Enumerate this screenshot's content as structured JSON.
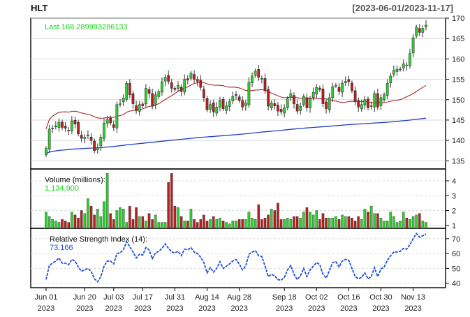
{
  "header": {
    "symbol": "HLT",
    "date_range": "[2023-06-01/2023-11-17]"
  },
  "colors": {
    "up": "#32cd32",
    "down": "#b22222",
    "sma50": "#a52a2a",
    "sma200": "#1e3ccf",
    "rsi": "#1e4fd6",
    "last_text": "#22cc22",
    "grid": "#d9d9d9"
  },
  "chart_data": [
    {
      "type": "candlestick",
      "title": "HLT",
      "label": "Last 168.289993286133",
      "x": [
        "2023-06-01",
        "2023-06-02",
        "2023-06-05",
        "2023-06-06",
        "2023-06-07",
        "2023-06-08",
        "2023-06-09",
        "2023-06-12",
        "2023-06-13",
        "2023-06-14",
        "2023-06-15",
        "2023-06-16",
        "2023-06-20",
        "2023-06-21",
        "2023-06-22",
        "2023-06-23",
        "2023-06-26",
        "2023-06-27",
        "2023-06-28",
        "2023-06-29",
        "2023-06-30",
        "2023-07-03",
        "2023-07-05",
        "2023-07-06",
        "2023-07-07",
        "2023-07-10",
        "2023-07-11",
        "2023-07-12",
        "2023-07-13",
        "2023-07-14",
        "2023-07-17",
        "2023-07-18",
        "2023-07-19",
        "2023-07-20",
        "2023-07-21",
        "2023-07-24",
        "2023-07-25",
        "2023-07-26",
        "2023-07-27",
        "2023-07-28",
        "2023-07-31",
        "2023-08-01",
        "2023-08-02",
        "2023-08-03",
        "2023-08-04",
        "2023-08-07",
        "2023-08-08",
        "2023-08-09",
        "2023-08-10",
        "2023-08-11",
        "2023-08-14",
        "2023-08-15",
        "2023-08-16",
        "2023-08-17",
        "2023-08-18",
        "2023-08-21",
        "2023-08-22",
        "2023-08-23",
        "2023-08-24",
        "2023-08-25",
        "2023-08-28",
        "2023-08-29",
        "2023-08-30",
        "2023-08-31",
        "2023-09-01",
        "2023-09-05",
        "2023-09-06",
        "2023-09-07",
        "2023-09-08",
        "2023-09-11",
        "2023-09-12",
        "2023-09-13",
        "2023-09-14",
        "2023-09-15",
        "2023-09-18",
        "2023-09-19",
        "2023-09-20",
        "2023-09-21",
        "2023-09-22",
        "2023-09-25",
        "2023-09-26",
        "2023-09-27",
        "2023-09-28",
        "2023-09-29",
        "2023-10-02",
        "2023-10-03",
        "2023-10-04",
        "2023-10-05",
        "2023-10-06",
        "2023-10-09",
        "2023-10-10",
        "2023-10-11",
        "2023-10-12",
        "2023-10-13",
        "2023-10-16",
        "2023-10-17",
        "2023-10-18",
        "2023-10-19",
        "2023-10-20",
        "2023-10-23",
        "2023-10-24",
        "2023-10-25",
        "2023-10-26",
        "2023-10-27",
        "2023-10-30",
        "2023-10-31",
        "2023-11-01",
        "2023-11-02",
        "2023-11-03",
        "2023-11-06",
        "2023-11-07",
        "2023-11-08",
        "2023-11-09",
        "2023-11-10",
        "2023-11-13",
        "2023-11-14",
        "2023-11-15",
        "2023-11-16",
        "2023-11-17"
      ],
      "close": [
        138.0,
        142.8,
        143.0,
        143.5,
        144.5,
        143.2,
        143.0,
        142.5,
        144.8,
        144.0,
        141.6,
        140.5,
        140.8,
        141.3,
        140.0,
        137.5,
        138.2,
        140.8,
        144.2,
        145.2,
        144.3,
        143.2,
        148.8,
        149.0,
        150.4,
        154.0,
        151.2,
        149.0,
        147.3,
        148.8,
        148.5,
        152.8,
        151.5,
        148.4,
        151.2,
        152.0,
        154.4,
        155.5,
        154.5,
        152.8,
        152.5,
        153.5,
        152.0,
        155.0,
        154.8,
        156.5,
        155.0,
        154.5,
        153.0,
        150.5,
        147.5,
        148.8,
        147.0,
        148.2,
        149.8,
        147.8,
        148.5,
        149.5,
        150.8,
        151.0,
        149.8,
        148.2,
        149.2,
        154.3,
        155.8,
        157.0,
        155.5,
        155.2,
        152.2,
        148.4,
        149.2,
        148.5,
        147.2,
        147.0,
        148.0,
        150.2,
        151.5,
        149.0,
        147.2,
        148.4,
        150.8,
        148.0,
        150.2,
        151.8,
        153.0,
        152.5,
        149.0,
        147.8,
        150.5,
        153.2,
        153.5,
        152.0,
        154.0,
        154.5,
        154.4,
        152.2,
        149.5,
        148.2,
        148.8,
        150.0,
        148.0,
        148.5,
        151.5,
        148.2,
        150.5,
        151.2,
        154.0,
        155.8,
        157.2,
        157.5,
        157.5,
        158.8,
        158.5,
        161.3,
        165.2,
        167.8,
        166.5,
        167.5,
        168.29
      ],
      "sma50_endpoints": {
        "start": 142.8,
        "end": 153.5
      },
      "sma200_endpoints": {
        "start": 136.8,
        "end": 147.3
      },
      "ylim": [
        133,
        170
      ],
      "yticks": [
        135,
        140,
        145,
        150,
        155,
        160,
        165,
        170
      ]
    },
    {
      "type": "bar",
      "label": "Volume (millions):",
      "value_label": "1,134,900",
      "volume": [
        1.9,
        1.6,
        1.4,
        1.3,
        1.2,
        1.4,
        1.3,
        1.2,
        1.9,
        1.7,
        1.5,
        2.0,
        1.8,
        2.8,
        2.3,
        1.7,
        2.1,
        1.6,
        2.6,
        4.5,
        1.8,
        1.4,
        2.0,
        2.2,
        2.1,
        1.2,
        2.3,
        1.4,
        2.2,
        1.6,
        1.6,
        1.3,
        1.8,
        1.4,
        1.7,
        1.2,
        1.2,
        1.2,
        3.9,
        4.5,
        2.3,
        2.2,
        1.6,
        1.3,
        1.3,
        2.1,
        1.4,
        1.2,
        1.4,
        1.7,
        1.3,
        1.4,
        1.6,
        1.4,
        1.5,
        1.3,
        1.2,
        1.1,
        1.3,
        1.3,
        1.4,
        1.4,
        1.4,
        1.9,
        1.5,
        1.4,
        2.4,
        1.4,
        1.5,
        1.7,
        2.1,
        2.0,
        2.5,
        1.4,
        1.4,
        1.5,
        1.4,
        1.6,
        1.6,
        1.5,
        1.9,
        2.2,
        1.9,
        1.7,
        2.0,
        1.4,
        1.8,
        1.5,
        1.5,
        1.5,
        1.6,
        1.4,
        1.7,
        1.6,
        1.6,
        1.5,
        1.3,
        1.6,
        1.4,
        2.1,
        1.9,
        2.3,
        1.8,
        1.8,
        1.5,
        1.3,
        1.3,
        1.9,
        1.6,
        1.2,
        1.3,
        1.9,
        1.5,
        1.4,
        1.6,
        1.7,
        1.8,
        1.3,
        1.2
      ],
      "ylim": [
        0.8,
        4.8
      ],
      "yticks": [
        1,
        2,
        3,
        4
      ]
    },
    {
      "type": "line",
      "label": "Relative Strength Index (14):",
      "value_label": "73.166",
      "rsi": [
        42.5,
        52.0,
        53.5,
        55.0,
        57.0,
        53.5,
        53.5,
        52.5,
        56.0,
        55.0,
        51.0,
        48.0,
        49.0,
        50.0,
        48.0,
        43.0,
        41.0,
        44.5,
        51.5,
        55.0,
        55.0,
        53.0,
        60.0,
        60.5,
        62.5,
        68.0,
        64.5,
        61.0,
        57.0,
        59.5,
        59.0,
        64.0,
        62.5,
        56.5,
        60.5,
        61.5,
        63.5,
        66.5,
        63.5,
        61.0,
        60.5,
        61.5,
        58.5,
        63.0,
        62.5,
        64.0,
        61.0,
        60.0,
        57.5,
        54.0,
        47.0,
        50.5,
        47.5,
        50.0,
        54.5,
        50.0,
        51.5,
        53.0,
        55.0,
        56.0,
        53.0,
        49.0,
        51.5,
        59.5,
        61.0,
        62.0,
        58.5,
        58.0,
        51.5,
        44.5,
        46.0,
        45.0,
        42.5,
        42.0,
        44.0,
        49.0,
        52.0,
        46.0,
        42.5,
        45.0,
        50.0,
        44.5,
        49.0,
        51.5,
        54.0,
        52.5,
        46.0,
        43.5,
        48.5,
        54.0,
        54.5,
        51.0,
        55.0,
        56.0,
        55.5,
        50.0,
        44.5,
        43.0,
        44.0,
        47.0,
        43.0,
        44.5,
        50.5,
        44.5,
        49.5,
        51.0,
        55.5,
        58.5,
        61.0,
        61.0,
        61.5,
        63.5,
        63.0,
        66.0,
        70.0,
        73.5,
        71.0,
        72.0,
        73.166
      ],
      "ylim": [
        37,
        77
      ],
      "yticks": [
        40,
        50,
        60,
        70
      ]
    }
  ],
  "x_axis": {
    "ticks": [
      {
        "label": "Jun 01",
        "year": "2023",
        "index": 0
      },
      {
        "label": "Jun 20",
        "year": "2023",
        "index": 12
      },
      {
        "label": "Jul 03",
        "year": "2023",
        "index": 21
      },
      {
        "label": "Jul 17",
        "year": "2023",
        "index": 30
      },
      {
        "label": "Jul 31",
        "year": "2023",
        "index": 40
      },
      {
        "label": "Aug 14",
        "year": "2023",
        "index": 50
      },
      {
        "label": "Aug 28",
        "year": "2023",
        "index": 60
      },
      {
        "label": "Sep 18",
        "year": "2023",
        "index": 74
      },
      {
        "label": "Oct 02",
        "year": "2023",
        "index": 84
      },
      {
        "label": "Oct 16",
        "year": "2023",
        "index": 94
      },
      {
        "label": "Oct 30",
        "year": "2023",
        "index": 104
      },
      {
        "label": "Nov 13",
        "year": "2023",
        "index": 114
      }
    ]
  }
}
